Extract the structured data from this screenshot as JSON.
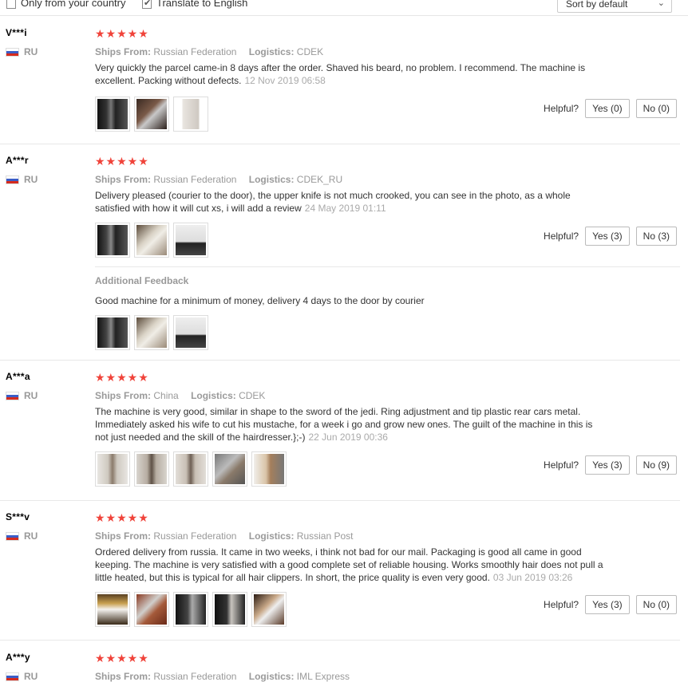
{
  "filters": {
    "only_country_label": "Only from your country",
    "translate_label": "Translate to English",
    "sort_value": "Sort by default"
  },
  "labels": {
    "ships_from": "Ships From:",
    "logistics": "Logistics:",
    "helpful": "Helpful?",
    "additional_feedback": "Additional Feedback",
    "stars": "★★★★★"
  },
  "colors": {
    "star": "#f0433a",
    "muted": "#999999"
  },
  "reviews": [
    {
      "user": "V***i",
      "country": "RU",
      "rating": 5,
      "ships_from": "Russian Federation",
      "logistics": "CDEK",
      "text": "Very quickly the parcel came-in 8 days after the order. Shaved his beard, no problem. I recommend. The machine is excellent. Packing without defects.",
      "date": "12 Nov 2019 06:58",
      "photo_count": 3,
      "yes": "Yes (0)",
      "no": "No (0)"
    },
    {
      "user": "A***r",
      "country": "RU",
      "rating": 5,
      "ships_from": "Russian Federation",
      "logistics": "CDEK_RU",
      "text": "Delivery pleased (courier to the door), the upper knife is not much crooked, you can see in the photo, as a whole satisfied with how it will cut xs, i will add a review",
      "date": "24 May 2019 01:11",
      "photo_count": 3,
      "yes": "Yes (3)",
      "no": "No (3)",
      "additional": {
        "text": "Good machine for a minimum of money, delivery 4 days to the door by courier",
        "photo_count": 3
      }
    },
    {
      "user": "A***a",
      "country": "RU",
      "rating": 5,
      "ships_from": "China",
      "logistics": "CDEK",
      "text": "The machine is very good, similar in shape to the sword of the jedi. Ring adjustment and tip plastic rear cars metal. Immediately asked his wife to cut his mustache, for a week i go and grow new ones. The guilt of the machine in this is not just needed and the skill of the hairdresser.};-)",
      "date": "22 Jun 2019 00:36",
      "photo_count": 5,
      "yes": "Yes (3)",
      "no": "No (9)"
    },
    {
      "user": "S***v",
      "country": "RU",
      "rating": 5,
      "ships_from": "Russian Federation",
      "logistics": "Russian Post",
      "text": "Ordered delivery from russia. It came in two weeks, i think not bad for our mail. Packaging is good all came in good keeping. The machine is very satisfied with a good complete set of reliable housing. Works smoothly hair does not pull a little heated, but this is typical for all hair clippers. In short, the price quality is even very good.",
      "date": "03 Jun 2019 03:26",
      "photo_count": 5,
      "yes": "Yes (3)",
      "no": "No (0)"
    },
    {
      "user": "A***y",
      "country": "RU",
      "rating": 5,
      "ships_from": "Russian Federation",
      "logistics": "IML Express"
    }
  ]
}
